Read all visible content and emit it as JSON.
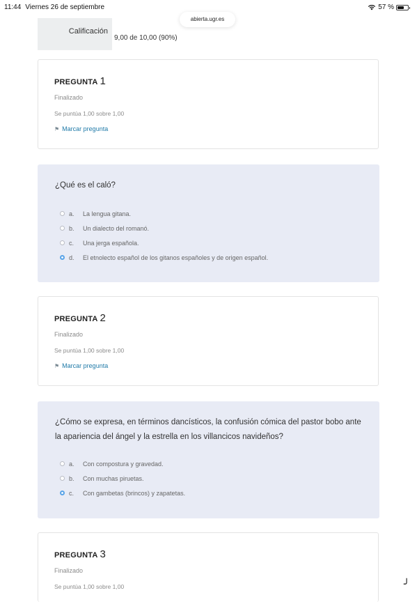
{
  "status_bar": {
    "time": "11:44",
    "date": "Viernes 26 de septiembre",
    "battery": "57 %"
  },
  "browser": {
    "url": "abierta.ugr.es"
  },
  "summary": {
    "label": "Calificación",
    "value": "9,00 de 10,00 (90%)"
  },
  "questions": [
    {
      "header": "PREGUNTA",
      "number": "1",
      "state": "Finalizado",
      "grade": "Se puntúa 1,00 sobre 1,00",
      "flag_label": "Marcar pregunta",
      "text": "¿Qué es el caló?",
      "answers": [
        {
          "letter": "a.",
          "text": "La lengua gitana.",
          "selected": false
        },
        {
          "letter": "b.",
          "text": "Un dialecto del romanó.",
          "selected": false
        },
        {
          "letter": "c.",
          "text": "Una jerga española.",
          "selected": false
        },
        {
          "letter": "d.",
          "text": "El etnolecto español de los gitanos españoles y de origen español.",
          "selected": true
        }
      ]
    },
    {
      "header": "PREGUNTA",
      "number": "2",
      "state": "Finalizado",
      "grade": "Se puntúa 1,00 sobre 1,00",
      "flag_label": "Marcar pregunta",
      "text": "¿Cómo se expresa, en términos dancísticos, la confusión cómica del pastor bobo ante la apariencia del ángel y la estrella en los villancicos navideños?",
      "answers": [
        {
          "letter": "a.",
          "text": "Con compostura y gravedad.",
          "selected": false
        },
        {
          "letter": "b.",
          "text": "Con muchas piruetas.",
          "selected": false
        },
        {
          "letter": "c.",
          "text": "Con gambetas (brincos) y zapatetas.",
          "selected": true
        }
      ]
    },
    {
      "header": "PREGUNTA",
      "number": "3",
      "state": "Finalizado",
      "grade": "Se puntúa 1,00 sobre 1,00"
    }
  ]
}
